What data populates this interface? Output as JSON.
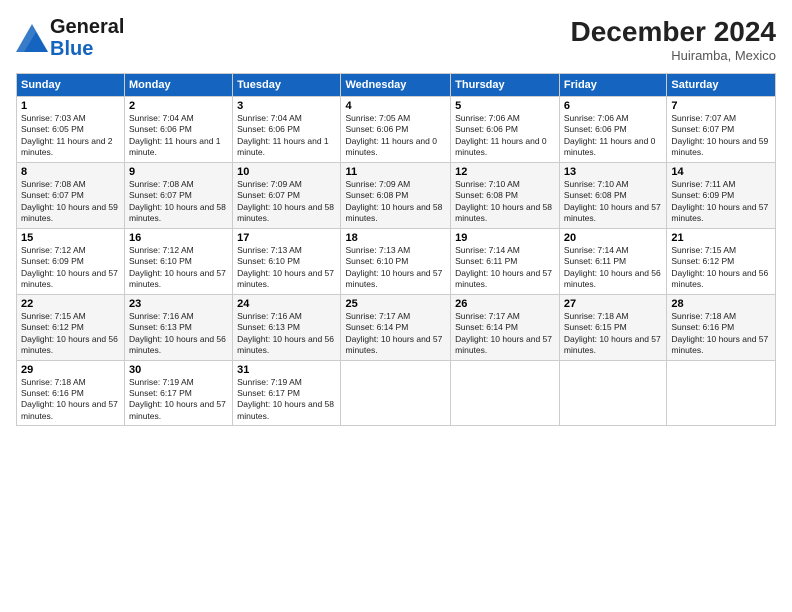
{
  "logo": {
    "line1": "General",
    "line2": "Blue"
  },
  "title": "December 2024",
  "location": "Huiramba, Mexico",
  "weekdays": [
    "Sunday",
    "Monday",
    "Tuesday",
    "Wednesday",
    "Thursday",
    "Friday",
    "Saturday"
  ],
  "weeks": [
    [
      {
        "day": "1",
        "sunrise": "7:03 AM",
        "sunset": "6:05 PM",
        "daylight": "11 hours and 2 minutes."
      },
      {
        "day": "2",
        "sunrise": "7:04 AM",
        "sunset": "6:06 PM",
        "daylight": "11 hours and 1 minute."
      },
      {
        "day": "3",
        "sunrise": "7:04 AM",
        "sunset": "6:06 PM",
        "daylight": "11 hours and 1 minute."
      },
      {
        "day": "4",
        "sunrise": "7:05 AM",
        "sunset": "6:06 PM",
        "daylight": "11 hours and 0 minutes."
      },
      {
        "day": "5",
        "sunrise": "7:06 AM",
        "sunset": "6:06 PM",
        "daylight": "11 hours and 0 minutes."
      },
      {
        "day": "6",
        "sunrise": "7:06 AM",
        "sunset": "6:06 PM",
        "daylight": "11 hours and 0 minutes."
      },
      {
        "day": "7",
        "sunrise": "7:07 AM",
        "sunset": "6:07 PM",
        "daylight": "10 hours and 59 minutes."
      }
    ],
    [
      {
        "day": "8",
        "sunrise": "7:08 AM",
        "sunset": "6:07 PM",
        "daylight": "10 hours and 59 minutes."
      },
      {
        "day": "9",
        "sunrise": "7:08 AM",
        "sunset": "6:07 PM",
        "daylight": "10 hours and 58 minutes."
      },
      {
        "day": "10",
        "sunrise": "7:09 AM",
        "sunset": "6:07 PM",
        "daylight": "10 hours and 58 minutes."
      },
      {
        "day": "11",
        "sunrise": "7:09 AM",
        "sunset": "6:08 PM",
        "daylight": "10 hours and 58 minutes."
      },
      {
        "day": "12",
        "sunrise": "7:10 AM",
        "sunset": "6:08 PM",
        "daylight": "10 hours and 58 minutes."
      },
      {
        "day": "13",
        "sunrise": "7:10 AM",
        "sunset": "6:08 PM",
        "daylight": "10 hours and 57 minutes."
      },
      {
        "day": "14",
        "sunrise": "7:11 AM",
        "sunset": "6:09 PM",
        "daylight": "10 hours and 57 minutes."
      }
    ],
    [
      {
        "day": "15",
        "sunrise": "7:12 AM",
        "sunset": "6:09 PM",
        "daylight": "10 hours and 57 minutes."
      },
      {
        "day": "16",
        "sunrise": "7:12 AM",
        "sunset": "6:10 PM",
        "daylight": "10 hours and 57 minutes."
      },
      {
        "day": "17",
        "sunrise": "7:13 AM",
        "sunset": "6:10 PM",
        "daylight": "10 hours and 57 minutes."
      },
      {
        "day": "18",
        "sunrise": "7:13 AM",
        "sunset": "6:10 PM",
        "daylight": "10 hours and 57 minutes."
      },
      {
        "day": "19",
        "sunrise": "7:14 AM",
        "sunset": "6:11 PM",
        "daylight": "10 hours and 57 minutes."
      },
      {
        "day": "20",
        "sunrise": "7:14 AM",
        "sunset": "6:11 PM",
        "daylight": "10 hours and 56 minutes."
      },
      {
        "day": "21",
        "sunrise": "7:15 AM",
        "sunset": "6:12 PM",
        "daylight": "10 hours and 56 minutes."
      }
    ],
    [
      {
        "day": "22",
        "sunrise": "7:15 AM",
        "sunset": "6:12 PM",
        "daylight": "10 hours and 56 minutes."
      },
      {
        "day": "23",
        "sunrise": "7:16 AM",
        "sunset": "6:13 PM",
        "daylight": "10 hours and 56 minutes."
      },
      {
        "day": "24",
        "sunrise": "7:16 AM",
        "sunset": "6:13 PM",
        "daylight": "10 hours and 56 minutes."
      },
      {
        "day": "25",
        "sunrise": "7:17 AM",
        "sunset": "6:14 PM",
        "daylight": "10 hours and 57 minutes."
      },
      {
        "day": "26",
        "sunrise": "7:17 AM",
        "sunset": "6:14 PM",
        "daylight": "10 hours and 57 minutes."
      },
      {
        "day": "27",
        "sunrise": "7:18 AM",
        "sunset": "6:15 PM",
        "daylight": "10 hours and 57 minutes."
      },
      {
        "day": "28",
        "sunrise": "7:18 AM",
        "sunset": "6:16 PM",
        "daylight": "10 hours and 57 minutes."
      }
    ],
    [
      {
        "day": "29",
        "sunrise": "7:18 AM",
        "sunset": "6:16 PM",
        "daylight": "10 hours and 57 minutes."
      },
      {
        "day": "30",
        "sunrise": "7:19 AM",
        "sunset": "6:17 PM",
        "daylight": "10 hours and 57 minutes."
      },
      {
        "day": "31",
        "sunrise": "7:19 AM",
        "sunset": "6:17 PM",
        "daylight": "10 hours and 58 minutes."
      },
      null,
      null,
      null,
      null
    ]
  ]
}
